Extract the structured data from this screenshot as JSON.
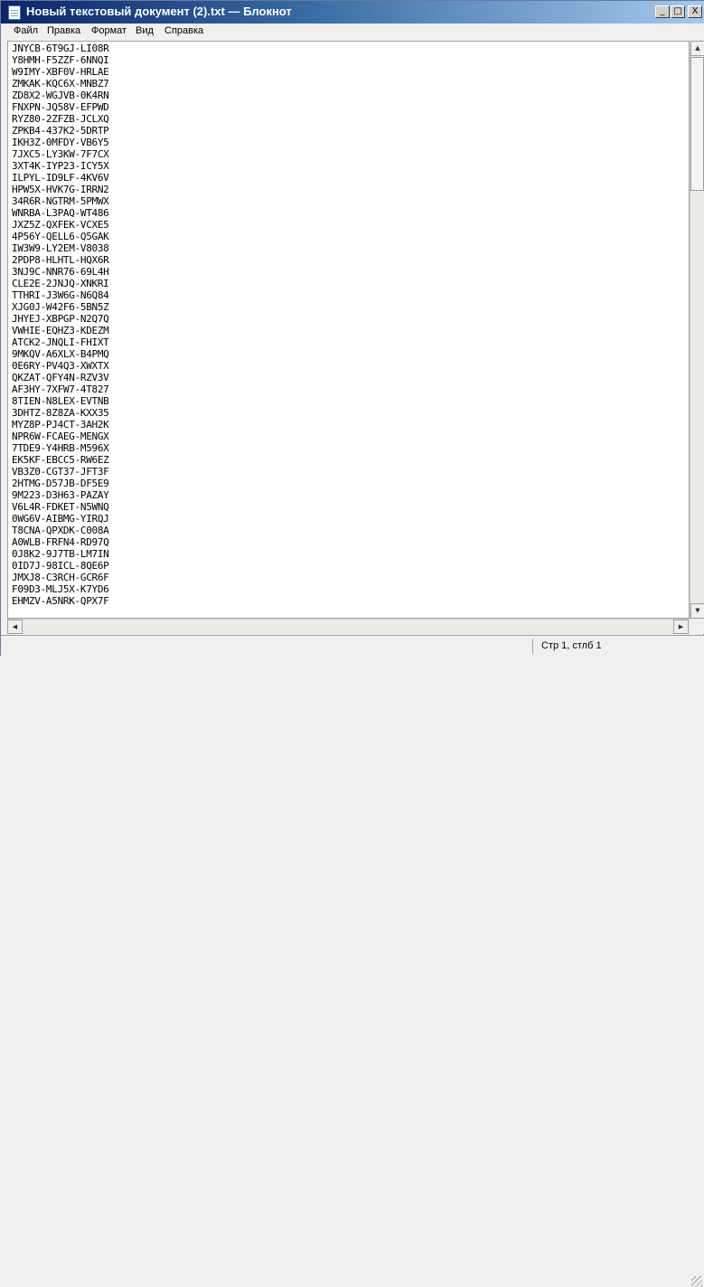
{
  "window": {
    "title": "Новый текстовый документ (2).txt — Блокнот",
    "icon": "notepad-icon"
  },
  "title_buttons": {
    "minimize": "_",
    "maximize": "□",
    "close": "X"
  },
  "menu": [
    {
      "label": "Файл"
    },
    {
      "label": "Правка"
    },
    {
      "label": "Формат"
    },
    {
      "label": "Вид"
    },
    {
      "label": "Справка"
    }
  ],
  "document": {
    "lines": [
      "JNYCB-6T9GJ-LI08R",
      "Y8HMH-F5ZZF-6NNQI",
      "W9IMY-XBF0V-HRLAE",
      "ZMKAK-KQC6X-MNBZ7",
      "ZD8X2-WGJVB-0K4RN",
      "FNXPN-JQ58V-EFPWD",
      "RYZ80-2ZFZB-JCLXQ",
      "ZPKB4-437K2-5DRTP",
      "IKH3Z-0MFDY-VB6Y5",
      "7JXC5-LY3KW-7F7CX",
      "3XT4K-IYP23-ICY5X",
      "ILPYL-ID9LF-4KV6V",
      "HPW5X-HVK7G-IRRN2",
      "34R6R-NGTRM-5PMWX",
      "WNRBA-L3PAQ-WT486",
      "JXZ5Z-QXFEK-VCXE5",
      "4P56Y-QELL6-Q5GAK",
      "IW3W9-LY2EM-V8038",
      "2PDP8-HLHTL-HQX6R",
      "3NJ9C-NNR76-69L4H",
      "CLE2E-2JNJQ-XNKRI",
      "TTHRI-J3W6G-N6Q84",
      "XJG0J-W42F6-5BN5Z",
      "JHYEJ-XBPGP-N2Q7Q",
      "VWHIE-EQHZ3-KDEZM",
      "ATCK2-JNQLI-FHIXT",
      "9MKQV-A6XLX-B4PMQ",
      "0E6RY-PV4Q3-XWXTX",
      "QKZAT-QFY4N-RZV3V",
      "AF3HY-7XFW7-4T827",
      "8TIEN-N8LEX-EVTNB",
      "3DHTZ-8Z8ZA-KXX35",
      "MYZ8P-PJ4CT-3AH2K",
      "NPR6W-FCAEG-MENGX",
      "7TDE9-Y4HRB-M596X",
      "EK5KF-EBCC5-RW6EZ",
      "VB3Z0-CGT37-JFT3F",
      "2HTMG-D57JB-DF5E9",
      "9M223-D3H63-PAZAY",
      "V6L4R-FDKET-N5WNQ",
      "0WG6V-AIBMG-YIRQJ",
      "T8CNA-QPXDK-C008A",
      "A0WLB-FRFN4-RD97Q",
      "0J8K2-9J7TB-LM7IN",
      "0ID7J-98ICL-8QE6P",
      "JMXJ8-C3RCH-GCR6F",
      "F09D3-MLJ5X-K7YD6",
      "EHMZV-A5NRK-QPX7F"
    ]
  },
  "scroll_glyphs": {
    "up": "▲",
    "down": "▼",
    "left": "◀",
    "right": "▶"
  },
  "status": {
    "position": "Стр 1, стлб 1"
  }
}
